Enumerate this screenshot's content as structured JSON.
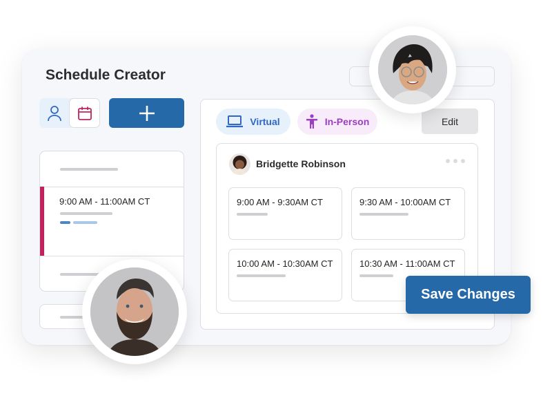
{
  "app": {
    "title": "Schedule Creator"
  },
  "toolbar": {
    "person_icon": "person-icon",
    "calendar_icon": "calendar-icon",
    "add_icon": "plus-icon"
  },
  "left_list": {
    "selected_time": "9:00 AM - 11:00AM CT"
  },
  "filters": {
    "virtual_label": "Virtual",
    "virtual_icon": "laptop-icon",
    "inperson_label": "In-Person",
    "inperson_icon": "person-standing-icon",
    "edit_label": "Edit"
  },
  "host_card": {
    "name": "Bridgette Robinson",
    "more_icon": "more-horizontal-icon",
    "slots": [
      {
        "time": "9:00 AM - 9:30AM CT"
      },
      {
        "time": "9:30 AM - 10:00AM CT"
      },
      {
        "time": "10:00 AM - 10:30AM CT"
      },
      {
        "time": "10:30 AM - 11:00AM CT"
      }
    ]
  },
  "actions": {
    "save_label": "Save Changes"
  },
  "colors": {
    "primary": "#2669a8",
    "accent_magenta": "#c0245f",
    "virtual_text": "#2f67c8",
    "inperson_text": "#9b3ec0"
  }
}
